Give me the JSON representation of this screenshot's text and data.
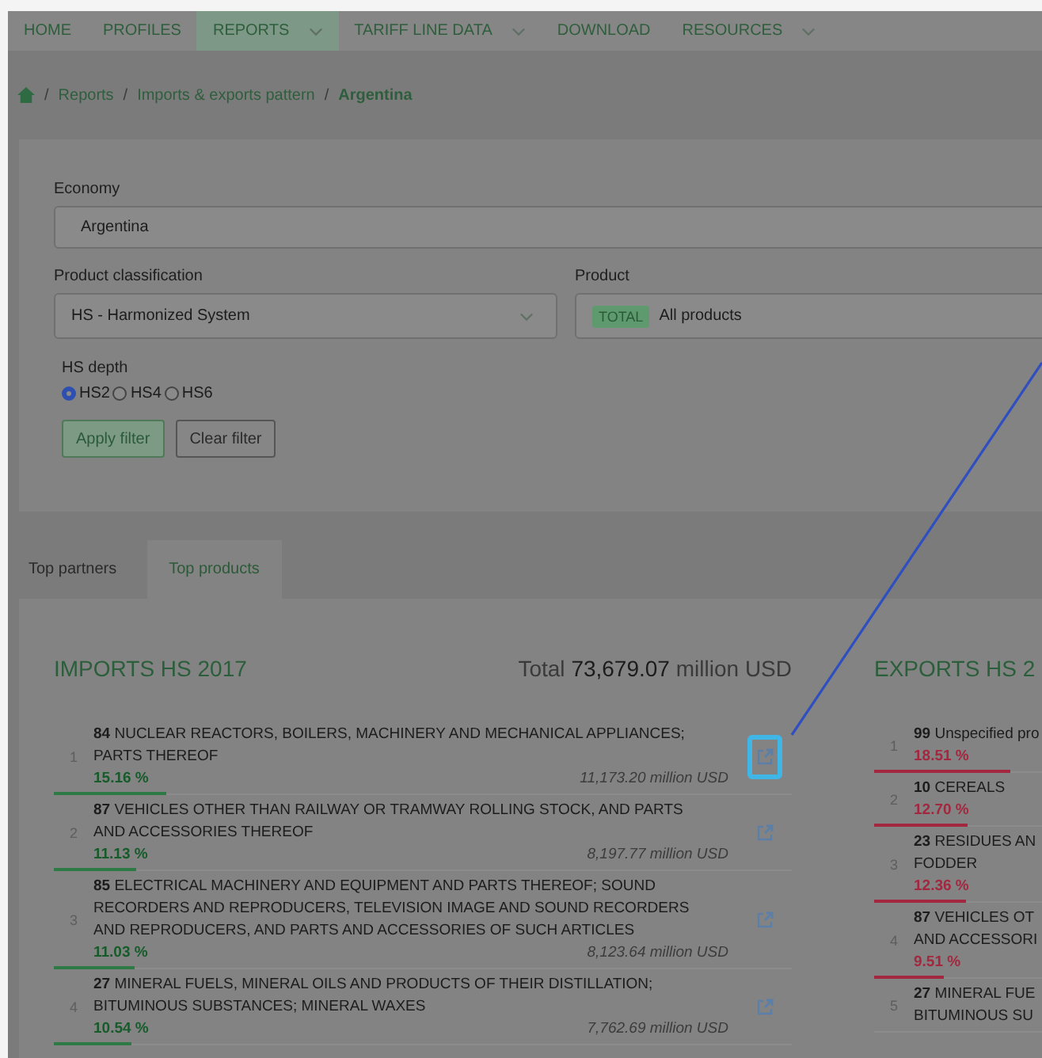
{
  "nav": [
    {
      "label": "HOME",
      "dropdown": false,
      "selected": false
    },
    {
      "label": "PROFILES",
      "dropdown": false,
      "selected": false
    },
    {
      "label": "REPORTS",
      "dropdown": true,
      "selected": true
    },
    {
      "label": "TARIFF LINE DATA",
      "dropdown": true,
      "selected": false
    },
    {
      "label": "DOWNLOAD",
      "dropdown": false,
      "selected": false
    },
    {
      "label": "RESOURCES",
      "dropdown": true,
      "selected": false
    }
  ],
  "breadcrumb": {
    "separator": "/",
    "items": [
      "Reports",
      "Imports & exports pattern"
    ],
    "current": "Argentina"
  },
  "filters": {
    "fields": [
      {
        "kind": "text",
        "label": "Economy",
        "value": "Argentina"
      },
      {
        "kind": "select",
        "label": "Product classification",
        "value": "HS - Harmonized System"
      },
      {
        "kind": "tag-select",
        "label": "Product",
        "tag": "TOTAL",
        "value": "All products"
      }
    ],
    "depth": {
      "label": "HS depth",
      "options": [
        {
          "label": "HS2",
          "selected": true
        },
        {
          "label": "HS4",
          "selected": false
        },
        {
          "label": "HS6",
          "selected": false
        }
      ]
    },
    "buttons": [
      {
        "label": "Apply filter",
        "kind": "primary"
      },
      {
        "label": "Clear filter",
        "kind": "secondary"
      }
    ]
  },
  "tabs": [
    {
      "label": "Top partners",
      "selected": false
    },
    {
      "label": "Top products",
      "selected": true
    }
  ],
  "imports": {
    "kind": "import",
    "title": "IMPORTS HS 2017",
    "total_label": "Total",
    "total_value": "73,679.07",
    "total_unit": "million USD",
    "items": [
      {
        "rank": "1",
        "name": "**84** NUCLEAR REACTORS, BOILERS, MACHINERY AND MECHANICAL APPLIANCES; PARTS THEREOF",
        "share": "15.16 %",
        "value": "11,173.20 million USD",
        "level": 0.1516,
        "highlighted": true
      },
      {
        "rank": "2",
        "name": "**87** VEHICLES OTHER THAN RAILWAY OR TRAMWAY ROLLING STOCK, AND PARTS AND ACCESSORIES THEREOF",
        "share": "11.13 %",
        "value": "8,197.77 million USD",
        "level": 0.1113,
        "highlighted": false
      },
      {
        "rank": "3",
        "name": "**85** ELECTRICAL MACHINERY AND EQUIPMENT AND PARTS THEREOF; SOUND RECORDERS AND REPRODUCERS, TELEVISION IMAGE AND SOUND RECORDERS AND REPRODUCERS, AND PARTS AND ACCESSORIES OF SUCH ARTICLES",
        "share": "11.03 %",
        "value": "8,123.64 million USD",
        "level": 0.1103,
        "highlighted": false
      },
      {
        "rank": "4",
        "name": "**27** MINERAL FUELS, MINERAL OILS AND PRODUCTS OF THEIR DISTILLATION; BITUMINOUS SUBSTANCES; MINERAL WAXES",
        "share": "10.54 %",
        "value": "7,762.69 million USD",
        "level": 0.1054,
        "highlighted": false
      }
    ]
  },
  "exports": {
    "kind": "export",
    "title": "EXPORTS HS 2",
    "items": [
      {
        "rank": "1",
        "lines": [
          "**99** Unspecified pro"
        ],
        "share": "18.51 %",
        "level": 0.1851
      },
      {
        "rank": "2",
        "lines": [
          "**10** CEREALS"
        ],
        "share": "12.70 %",
        "level": 0.127
      },
      {
        "rank": "3",
        "lines": [
          "**23** RESIDUES AN",
          "FODDER"
        ],
        "share": "12.36 %",
        "level": 0.1236
      },
      {
        "rank": "4",
        "lines": [
          "**87** VEHICLES OT",
          "AND ACCESSORI"
        ],
        "share": "9.51 %",
        "level": 0.0951
      },
      {
        "rank": "5",
        "lines": [
          "**27** MINERAL FUE",
          "BITUMINOUS SU"
        ]
      }
    ]
  }
}
